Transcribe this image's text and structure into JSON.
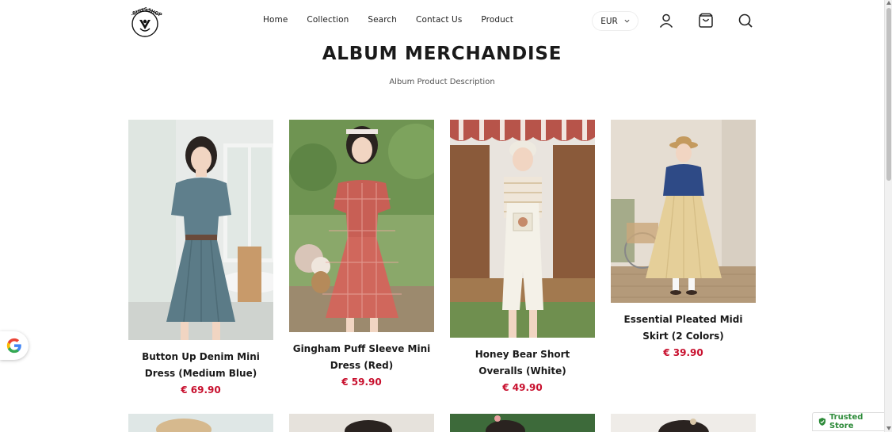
{
  "header": {
    "logo_text": "SUITS SHOP",
    "nav": [
      "Home",
      "Collection",
      "Search",
      "Contact Us",
      "Product"
    ],
    "currency": "EUR",
    "icons": [
      "user-icon",
      "cart-icon",
      "search-icon"
    ]
  },
  "page": {
    "title": "ALBUM MERCHANDISE",
    "description": "Album Product Description"
  },
  "products": [
    {
      "name": "Button Up Denim Mini Dress (Medium Blue)",
      "price": "€ 69.90"
    },
    {
      "name": "Gingham Puff Sleeve Mini Dress (Red)",
      "price": "€ 59.90"
    },
    {
      "name": "Honey Bear Short Overalls (White)",
      "price": "€ 49.90"
    },
    {
      "name": "Essential Pleated Midi Skirt (2 Colors)",
      "price": "€ 39.90"
    }
  ],
  "badges": {
    "trusted": "Trusted Store",
    "google_icon": "google-icon"
  },
  "colors": {
    "price": "#c8102e",
    "trusted_green": "#2e8b3a"
  }
}
